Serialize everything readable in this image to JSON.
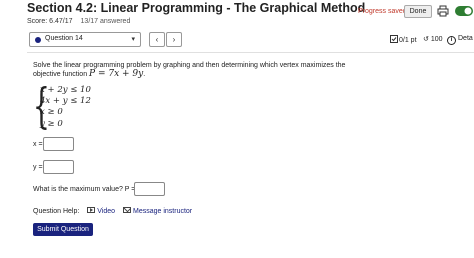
{
  "header": {
    "title": "Section 4.2: Linear Programming - The Graphical Method",
    "progress_status": "Progress saved",
    "done_label": "Done"
  },
  "score": {
    "label": "Score: 6.47/17",
    "answered": "13/17 answered"
  },
  "question_nav": {
    "selected": "Question 14",
    "prev_icon": "‹",
    "next_icon": "›",
    "points": "0/1 pt",
    "retries": "100",
    "details_label": "Deta"
  },
  "question": {
    "prompt": "Solve the linear programming problem by graphing and then determining which vertex maximizes the objective function",
    "objective": "P = 7x + 9y",
    "objective_suffix": ".",
    "constraints": [
      "x + 2y ≤ 10",
      "4x + y ≤ 12",
      "x ≥ 0",
      "y ≥ 0"
    ],
    "x_label": "x =",
    "y_label": "y =",
    "max_label": "What is the maximum value?  P =",
    "x_value": "",
    "y_value": "",
    "p_value": ""
  },
  "help": {
    "label": "Question Help:",
    "video": "Video",
    "message": "Message instructor"
  },
  "submit_label": "Submit Question",
  "colors": {
    "accent": "#1a237e",
    "progress_text": "#c0392b"
  }
}
